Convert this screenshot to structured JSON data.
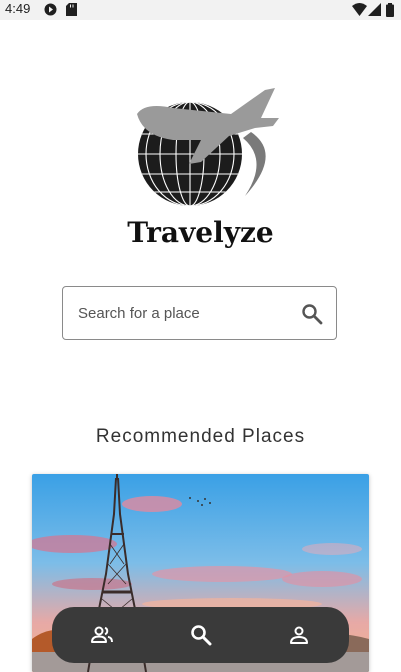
{
  "status_bar": {
    "time": "4:49",
    "left_icons": [
      "play-protect-icon",
      "sd-card-icon"
    ],
    "right_icons": [
      "wifi-icon",
      "signal-icon",
      "battery-icon"
    ]
  },
  "brand": {
    "name": "Travelyze",
    "logo_icon": "globe-airplane-logo"
  },
  "search": {
    "placeholder": "Search for a place",
    "icon": "search-icon"
  },
  "recommended": {
    "title": "Recommended Places",
    "cards": [
      {
        "image": "eiffel-tower-photo"
      }
    ]
  },
  "bottom_nav": {
    "items": [
      {
        "icon": "people-icon"
      },
      {
        "icon": "search-icon"
      },
      {
        "icon": "person-icon"
      }
    ]
  },
  "colors": {
    "nav_background": "#3a3a3a",
    "status_bar_background": "#f2f2f2",
    "text_dark": "#111111"
  }
}
